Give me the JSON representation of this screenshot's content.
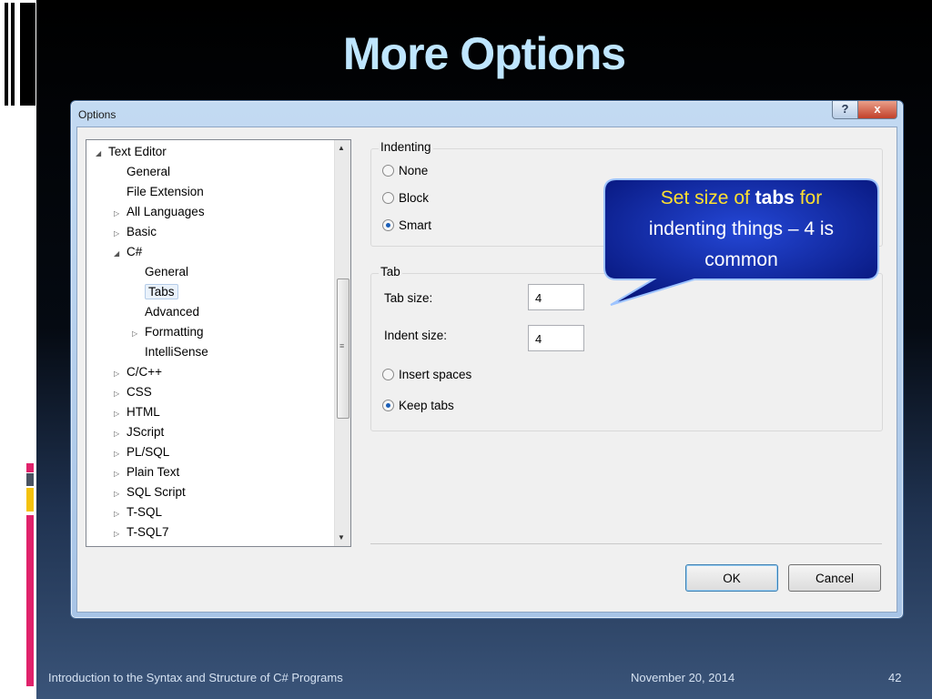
{
  "slide": {
    "title": "More Options",
    "footer_left": "Introduction to the Syntax and Structure of C# Programs",
    "footer_date": "November 20, 2014",
    "footer_page": "42"
  },
  "dialog": {
    "title": "Options",
    "help_label": "?",
    "close_label": "x",
    "ok_label": "OK",
    "cancel_label": "Cancel"
  },
  "tree": {
    "items": [
      {
        "label": "Text Editor",
        "level": 0,
        "expander": "expanded"
      },
      {
        "label": "General",
        "level": 1,
        "expander": "none"
      },
      {
        "label": "File Extension",
        "level": 1,
        "expander": "none"
      },
      {
        "label": "All Languages",
        "level": 1,
        "expander": "collapsed"
      },
      {
        "label": "Basic",
        "level": 1,
        "expander": "collapsed"
      },
      {
        "label": "C#",
        "level": 1,
        "expander": "expanded"
      },
      {
        "label": "General",
        "level": 2,
        "expander": "none"
      },
      {
        "label": "Tabs",
        "level": 2,
        "expander": "none",
        "selected": true
      },
      {
        "label": "Advanced",
        "level": 2,
        "expander": "none"
      },
      {
        "label": "Formatting",
        "level": 2,
        "expander": "collapsed"
      },
      {
        "label": "IntelliSense",
        "level": 2,
        "expander": "none"
      },
      {
        "label": "C/C++",
        "level": 1,
        "expander": "collapsed"
      },
      {
        "label": "CSS",
        "level": 1,
        "expander": "collapsed"
      },
      {
        "label": "HTML",
        "level": 1,
        "expander": "collapsed"
      },
      {
        "label": "JScript",
        "level": 1,
        "expander": "collapsed"
      },
      {
        "label": "PL/SQL",
        "level": 1,
        "expander": "collapsed"
      },
      {
        "label": "Plain Text",
        "level": 1,
        "expander": "collapsed"
      },
      {
        "label": "SQL Script",
        "level": 1,
        "expander": "collapsed"
      },
      {
        "label": "T-SQL",
        "level": 1,
        "expander": "collapsed"
      },
      {
        "label": "T-SQL7",
        "level": 1,
        "expander": "collapsed"
      }
    ]
  },
  "indenting": {
    "title": "Indenting",
    "options": [
      {
        "label": "None",
        "checked": false
      },
      {
        "label": "Block",
        "checked": false
      },
      {
        "label": "Smart",
        "checked": true
      }
    ]
  },
  "tab": {
    "title": "Tab",
    "tab_size_label": "Tab size:",
    "tab_size_value": "4",
    "indent_size_label": "Indent size:",
    "indent_size_value": "4",
    "options": [
      {
        "label": "Insert spaces",
        "checked": false
      },
      {
        "label": "Keep tabs",
        "checked": true
      }
    ]
  },
  "callout": {
    "prefix": "Set size of ",
    "bold": "tabs",
    "suffix": " for",
    "line2": "indenting things – 4 is",
    "line3": "common"
  },
  "colors": {
    "title": "#bfe6ff",
    "callout_fill": "#0d2aa8",
    "callout_text": "#ffe030",
    "accent_pink": "#e0226b",
    "accent_yellow": "#f4c20d",
    "accent_gray": "#4a5362"
  }
}
